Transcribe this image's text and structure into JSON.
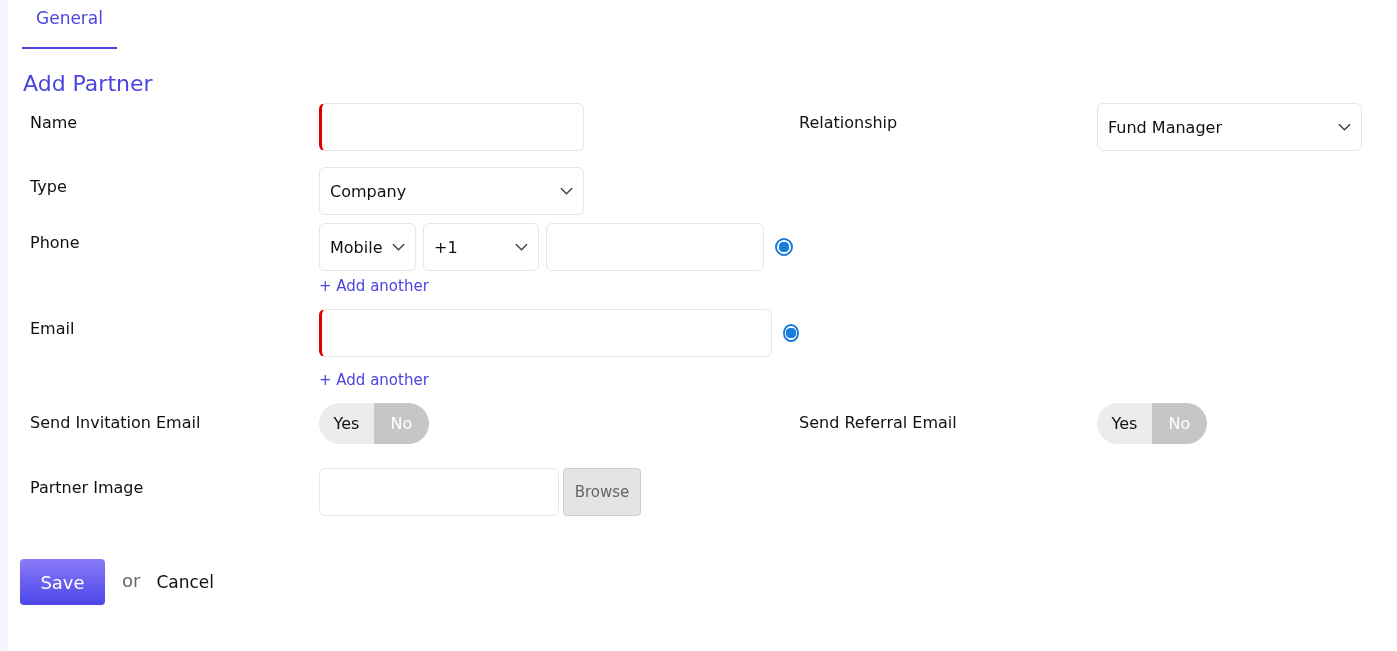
{
  "tabs": [
    {
      "label": "General",
      "selected": true
    }
  ],
  "title": "Add Partner",
  "name": {
    "label": "Name",
    "required": true
  },
  "relationship": {
    "label": "Relationship",
    "value": "Fund Manager"
  },
  "type": {
    "label": "Type",
    "value": "Company"
  },
  "phone": {
    "label": "Phone",
    "phone_type": "Mobile",
    "country_code": "+1",
    "primary": true,
    "add_link": "+ Add another"
  },
  "email": {
    "label": "Email",
    "required": true,
    "primary": true,
    "add_link": "+ Add another"
  },
  "invitation": {
    "label": "Send Invitation Email",
    "options": [
      {
        "label": "Yes",
        "selected": false
      },
      {
        "label": "No",
        "selected": true
      }
    ]
  },
  "referral": {
    "label": "Send Referral Email",
    "options": [
      {
        "label": "Yes",
        "selected": false
      },
      {
        "label": "No",
        "selected": true
      }
    ]
  },
  "image": {
    "label": "Partner Image",
    "button": "Browse"
  },
  "actions": {
    "save": "Save",
    "or": "or",
    "cancel": "Cancel"
  }
}
